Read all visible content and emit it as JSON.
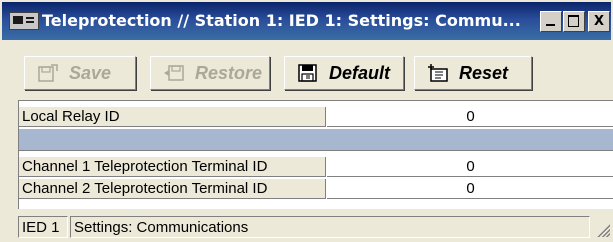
{
  "window": {
    "title": "Teleprotection // Station 1: IED 1: Settings: Commu...",
    "minimize_label": "_",
    "maximize_label": "□",
    "close_label": "X"
  },
  "toolbar": {
    "save_label": "Save",
    "restore_label": "Restore",
    "default_label": "Default",
    "reset_label": "Reset"
  },
  "settings": {
    "rows": [
      {
        "label": "Local Relay ID",
        "value": "0"
      },
      {
        "label": "Channel 1 Teleprotection Terminal ID",
        "value": "0"
      },
      {
        "label": "Channel 2 Teleprotection Terminal ID",
        "value": "0"
      }
    ]
  },
  "statusbar": {
    "device": "IED 1",
    "context": "Settings: Communications"
  },
  "colors": {
    "title_bar": "#0a246a",
    "window_face": "#ece9d8",
    "separator_row": "#a6b7cf",
    "disabled_text": "#aca899"
  },
  "icons": {
    "app": "ied-terminal-icon",
    "save": "save-icon",
    "restore": "restore-icon",
    "default": "default-icon",
    "reset": "reset-icon"
  }
}
